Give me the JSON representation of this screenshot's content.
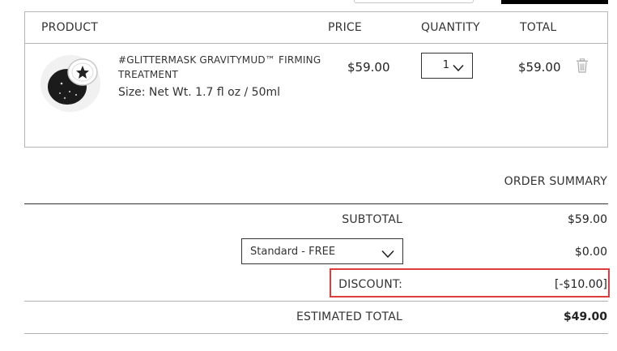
{
  "cart": {
    "headers": {
      "product": "PRODUCT",
      "price": "PRICE",
      "quantity": "QUANTITY",
      "total": "TOTAL"
    },
    "items": [
      {
        "name": "#GLITTERMASK GRAVITYMUD™ FIRMING TREATMENT",
        "size": "Size: Net Wt. 1.7 fl oz / 50ml",
        "price": "$59.00",
        "quantity": "1",
        "total": "$59.00",
        "remove_icon": "trash-icon",
        "image_icon": "product-jar-image"
      }
    ]
  },
  "summary": {
    "title": "ORDER SUMMARY",
    "subtotal_label": "SUBTOTAL",
    "subtotal_value": "$59.00",
    "shipping_option": "Standard - FREE",
    "shipping_value": "$0.00",
    "discount_label": "DISCOUNT:",
    "discount_value": "[-$10.00]",
    "estimated_total_label": "ESTIMATED TOTAL",
    "estimated_total_value": "$49.00"
  },
  "colors": {
    "highlight_border": "#e03c3c",
    "border": "#b5b5b5",
    "text": "#222222"
  }
}
